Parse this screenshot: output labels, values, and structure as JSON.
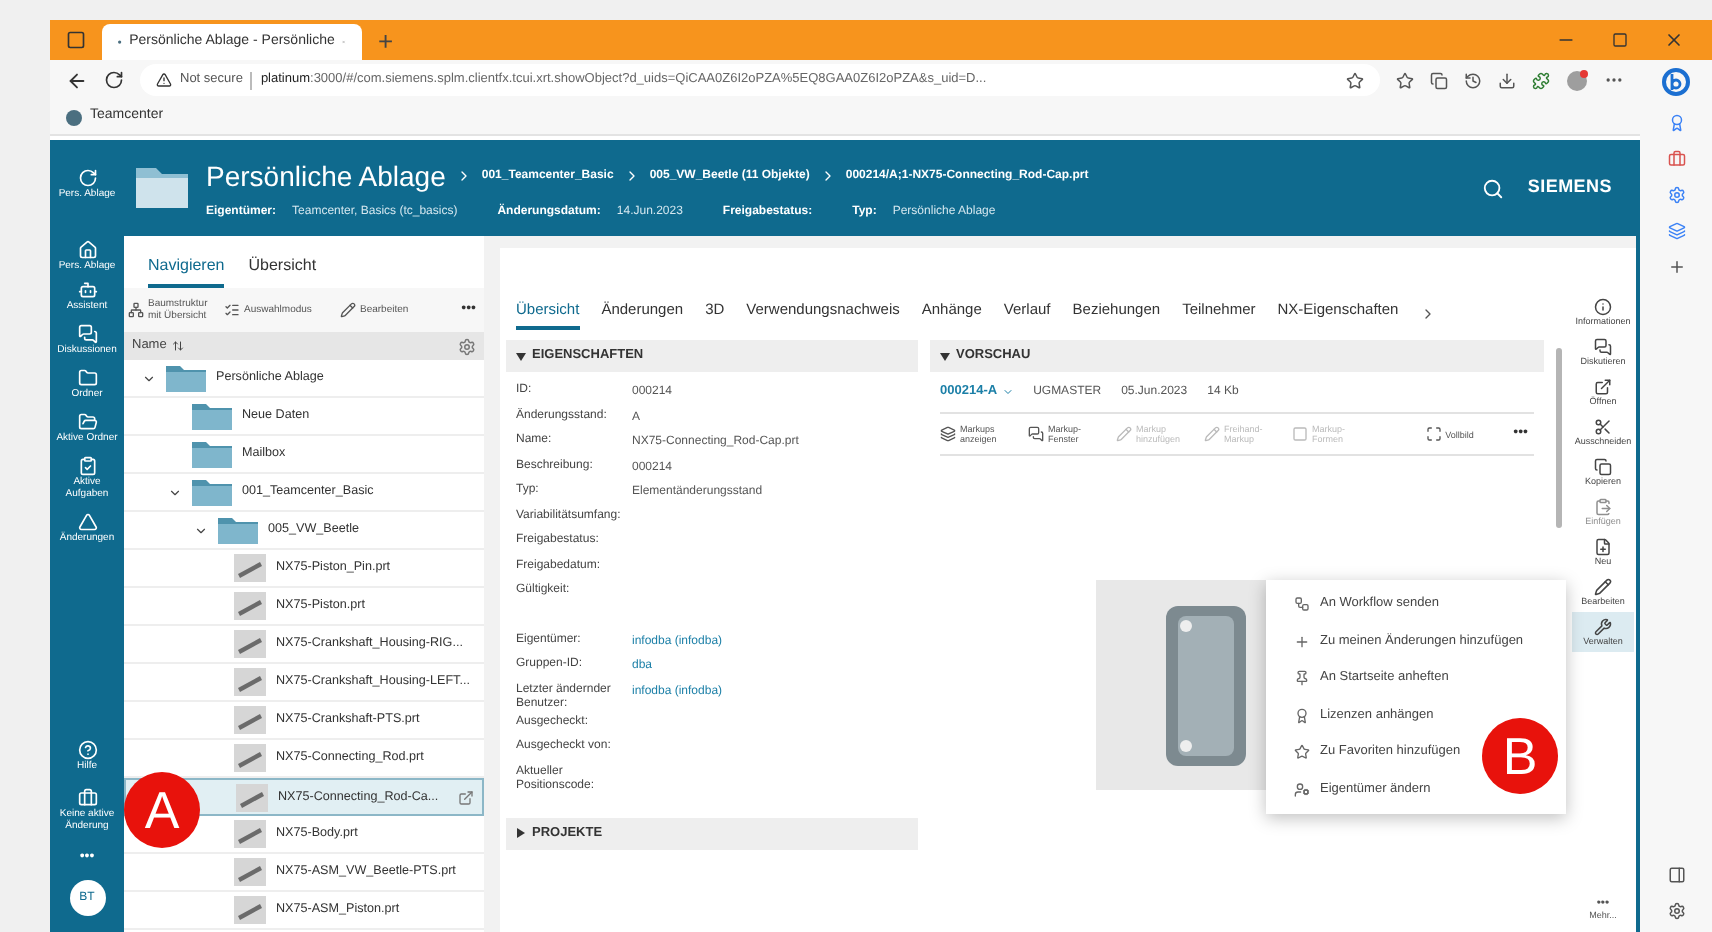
{
  "browser": {
    "tab_title": "Persönliche Ablage - Persönliche",
    "new_tab": "+",
    "security": "Not secure",
    "url_host": "platinum",
    "url_rest": ":3000/#/com.siemens.splm.clientfx.tcui.xrt.showObject?d_uids=QiCAA0Z6I2oPZA%5EQ8GAA0Z6I2oPZA&s_uid=D...",
    "bookmark": "Teamcenter"
  },
  "header": {
    "title": "Persönliche Ablage",
    "breadcrumbs": [
      "001_Teamcenter_Basic",
      "005_VW_Beetle (11 Objekte)",
      "000214/A;1-NX75-Connecting_Rod-Cap.prt"
    ],
    "meta": [
      {
        "label": "Eigentümer:",
        "value": "Teamcenter, Basics (tc_basics)"
      },
      {
        "label": "Änderungsdatum:",
        "value": "14.Jun.2023"
      },
      {
        "label": "Freigabestatus:"
      },
      {
        "label": "Typ:",
        "value": "Persönliche Ablage"
      }
    ],
    "brand": "SIEMENS"
  },
  "nav_rail": {
    "items": [
      "Pers. Ablage",
      "Pers. Ablage",
      "Assistent",
      "Diskussionen",
      "Ordner",
      "Aktive Ordner",
      "Aktive Aufgaben",
      "Änderungen"
    ],
    "bottom": [
      "Hilfe",
      "Keine aktive Änderung"
    ],
    "more": "•••",
    "avatar": "BT"
  },
  "left_panel": {
    "tabs": [
      {
        "label": "Navigieren",
        "selected": true
      },
      {
        "label": "Übersicht",
        "selected": false
      }
    ],
    "toolbar": [
      "Baumstruktur mit Übersicht",
      "Auswahlmodus",
      "Bearbeiten"
    ],
    "toolbar_more": "•••",
    "column": "Name",
    "tree": [
      {
        "label": "Persönliche Ablage",
        "kind": "folder",
        "selected": false,
        "expanded": true,
        "children": [
          {
            "label": "Neue Daten",
            "kind": "folder",
            "selected": false
          },
          {
            "label": "Mailbox",
            "kind": "folder",
            "selected": false
          },
          {
            "label": "001_Teamcenter_Basic",
            "kind": "folder",
            "selected": false,
            "expanded": true,
            "children": [
              {
                "label": "005_VW_Beetle",
                "kind": "folder",
                "selected": false,
                "expanded": true,
                "children": [
                  {
                    "label": "NX75-Piston_Pin.prt",
                    "kind": "part",
                    "selected": false
                  },
                  {
                    "label": "NX75-Piston.prt",
                    "kind": "part",
                    "selected": false
                  },
                  {
                    "label": "NX75-Crankshaft_Housing-RIG...",
                    "kind": "part",
                    "selected": false
                  },
                  {
                    "label": "NX75-Crankshaft_Housing-LEFT...",
                    "kind": "part",
                    "selected": false
                  },
                  {
                    "label": "NX75-Crankshaft-PTS.prt",
                    "kind": "part",
                    "selected": false
                  },
                  {
                    "label": "NX75-Connecting_Rod.prt",
                    "kind": "part",
                    "selected": false
                  },
                  {
                    "label": "NX75-Connecting_Rod-Ca...",
                    "kind": "part",
                    "selected": true
                  },
                  {
                    "label": "NX75-Body.prt",
                    "kind": "part",
                    "selected": false
                  },
                  {
                    "label": "NX75-ASM_VW_Beetle-PTS.prt",
                    "kind": "part",
                    "selected": false
                  },
                  {
                    "label": "NX75-ASM_Piston.prt",
                    "kind": "part",
                    "selected": false
                  }
                ]
              }
            ]
          }
        ]
      }
    ]
  },
  "detail_tabs": [
    {
      "label": "Übersicht",
      "selected": true
    },
    {
      "label": "Änderungen",
      "selected": false
    },
    {
      "label": "3D",
      "selected": false
    },
    {
      "label": "Verwendungsnachweis",
      "selected": false
    },
    {
      "label": "Anhänge",
      "selected": false
    },
    {
      "label": "Verlauf",
      "selected": false
    },
    {
      "label": "Beziehungen",
      "selected": false
    },
    {
      "label": "Teilnehmer",
      "selected": false
    },
    {
      "label": "NX-Eigenschaften",
      "selected": false
    }
  ],
  "properties": {
    "title": "EIGENSCHAFTEN",
    "expanded": true,
    "rows": [
      {
        "label": "ID:",
        "value": "000214",
        "kind": "text"
      },
      {
        "label": "Änderungsstand:",
        "value": "A",
        "kind": "text"
      },
      {
        "label": "Name:",
        "value": "NX75-Connecting_Rod-Cap.prt",
        "kind": "text"
      },
      {
        "label": "Beschreibung:",
        "value": "000214",
        "kind": "text"
      },
      {
        "label": "Typ:",
        "value": "Elementänderungsstand",
        "kind": "text"
      },
      {
        "label": "Variabilitätsumfang:"
      },
      {
        "label": "Freigabestatus:"
      },
      {
        "label": "Freigabedatum:"
      },
      {
        "label": "Gültigkeit:"
      },
      {
        "label": "Eigentümer:",
        "value": "infodba (infodba)",
        "kind": "link",
        "gap": true
      },
      {
        "label": "Gruppen-ID:",
        "value": "dba",
        "kind": "link"
      },
      {
        "label": "Letzter ändernder Benutzer:",
        "value": "infodba (infodba)",
        "kind": "link"
      },
      {
        "label": "Ausgecheckt:"
      },
      {
        "label": "Ausgecheckt von:"
      },
      {
        "label": "Aktueller Positionscode:"
      }
    ]
  },
  "projects": {
    "title": "PROJEKTE",
    "expanded": false
  },
  "preview": {
    "title": "VORSCHAU",
    "expanded": true,
    "revision": "000214-A",
    "dataset": "UGMASTER",
    "date": "05.Jun.2023",
    "size": "14 Kb",
    "tools": [
      {
        "label": "Markups anzeigen",
        "disabled": false
      },
      {
        "label": "Markup-Fenster",
        "disabled": false
      },
      {
        "label": "Markup hinzufügen",
        "disabled": true
      },
      {
        "label": "Freihand-Markup",
        "disabled": true
      },
      {
        "label": "Markup-Formen",
        "disabled": true
      },
      {
        "label": "Vollbild",
        "disabled": false
      }
    ],
    "tools_more": "•••"
  },
  "context_menu": [
    "An Workflow senden",
    "Zu meinen Änderungen hinzufügen",
    "An Startseite anheften",
    "Lizenzen anhängen",
    "Zu Favoriten hinzufügen",
    "Eigentümer ändern"
  ],
  "right_rail": {
    "items": [
      {
        "label": "Informationen",
        "disabled": false,
        "selected": false
      },
      {
        "label": "Diskutieren",
        "disabled": false,
        "selected": false
      },
      {
        "label": "Öffnen",
        "disabled": false,
        "selected": false
      },
      {
        "label": "Ausschneiden",
        "disabled": false,
        "selected": false
      },
      {
        "label": "Kopieren",
        "disabled": false,
        "selected": false
      },
      {
        "label": "Einfügen",
        "disabled": true,
        "selected": false
      },
      {
        "label": "Neu",
        "disabled": false,
        "selected": false
      },
      {
        "label": "Bearbeiten",
        "disabled": false,
        "selected": false
      },
      {
        "label": "Verwalten",
        "disabled": false,
        "selected": true
      }
    ],
    "more": "•••",
    "more_label": "Mehr..."
  },
  "markers": [
    "A",
    "B"
  ]
}
